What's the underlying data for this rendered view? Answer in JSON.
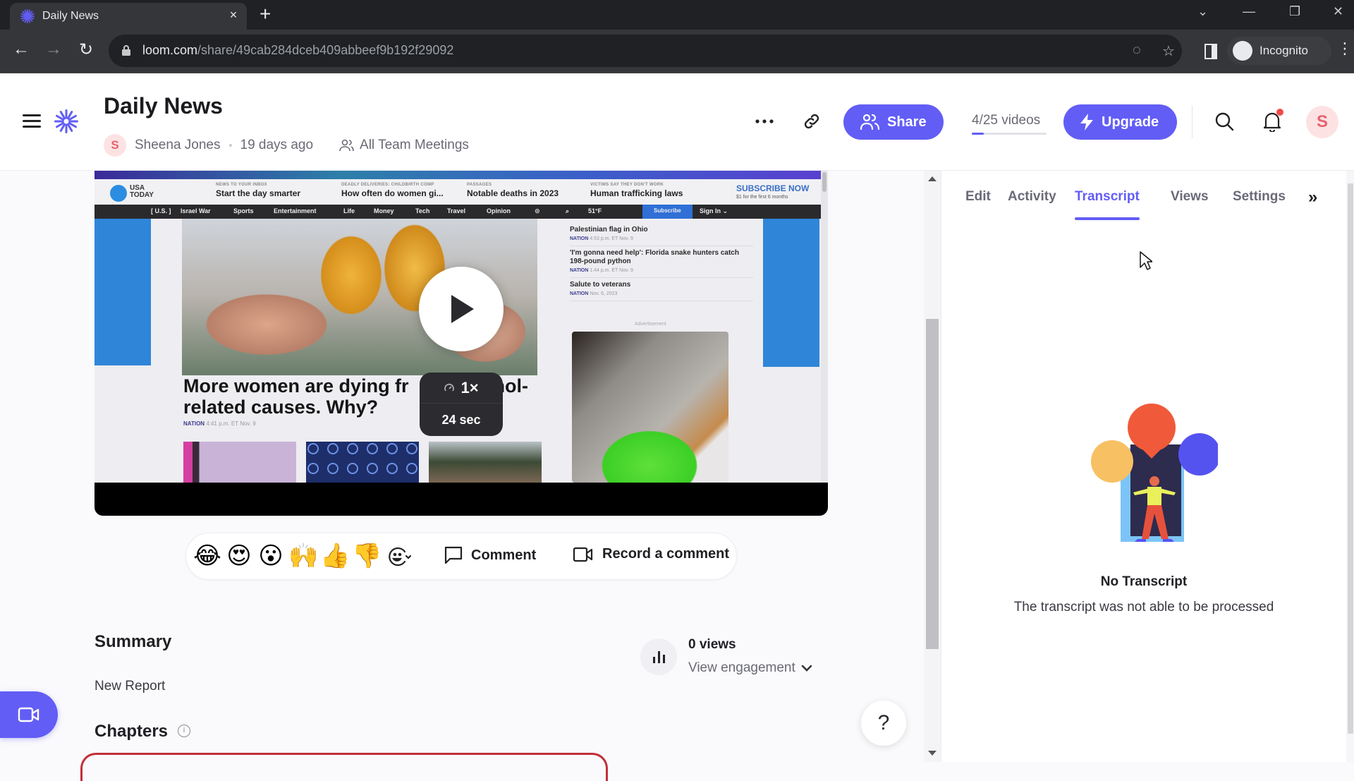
{
  "browser": {
    "tab_title": "Daily News",
    "tab_close": "×",
    "new_tab": "+",
    "url_host": "loom.com",
    "url_path": "/share/49cab284dceb409abbeef9b192f29092",
    "profile_label": "Incognito",
    "window_controls": [
      "chevron-down",
      "minimize",
      "restore",
      "close"
    ]
  },
  "header": {
    "title": "Daily News",
    "author_initial": "S",
    "author_name": "Sheena Jones",
    "time_ago": "19 days ago",
    "folder": "All Team Meetings",
    "share_label": "Share",
    "videos_count": "4/25 videos",
    "videos_used_fraction": 0.16,
    "upgrade_label": "Upgrade",
    "user_initial": "S",
    "accent_color": "#625df5"
  },
  "video": {
    "frame": {
      "logo_line1": "USA",
      "logo_line2": "TODAY",
      "header_items": [
        {
          "kicker": "NEWS TO YOUR INBOX",
          "headline": "Start the day smarter"
        },
        {
          "kicker": "DEADLY DELIVERIES: CHILDBIRTH COMP",
          "headline": "How often do women gi..."
        },
        {
          "kicker": "PASSAGES",
          "headline": "Notable deaths in 2023"
        },
        {
          "kicker": "VICTIMS SAY THEY DON'T WORK",
          "headline": "Human trafficking laws"
        }
      ],
      "subscribe_now": "SUBSCRIBE NOW",
      "subscribe_offer": "$1 for the first 6 months",
      "nav": [
        "[ U.S. ]",
        "Israel War",
        "Sports",
        "Entertainment",
        "Life",
        "Money",
        "Tech",
        "Travel",
        "Opinion"
      ],
      "weather": "51°F",
      "nav_subscribe": "Subscribe",
      "nav_signin": "Sign In ⌄",
      "main_headline": "More women are dying from alcohol-related causes. Why?",
      "main_headline_visible_l1": "More women are dying fr",
      "main_headline_visible_l1b": "hol-",
      "main_headline_visible_l2": "related causes. Why?",
      "main_meta_tag": "NATION",
      "main_meta_time": "4:41 p.m. ET Nov. 9",
      "stories": [
        {
          "title": "Palestinian flag in Ohio",
          "tag": "NATION",
          "time": "4:53 p.m. ET Nov. 9"
        },
        {
          "title": "'I'm gonna need help': Florida snake hunters catch 198-pound python",
          "tag": "NATION",
          "time": "1:44 p.m. ET Nov. 9"
        },
        {
          "title": "Salute to veterans",
          "tag": "NATION",
          "time": "Nov. 6, 2023"
        }
      ],
      "ad_label": "Advertisement"
    },
    "speed": "1×",
    "duration": "24 sec"
  },
  "reactions": {
    "emojis": [
      "😂",
      "😍",
      "😮",
      "🙌",
      "👍",
      "👎"
    ],
    "comment_label": "Comment",
    "record_comment_label": "Record a comment"
  },
  "summary": {
    "title": "Summary",
    "text": "New Report",
    "chapters_title": "Chapters",
    "chapters_info": "i"
  },
  "engagement": {
    "views": "0 views",
    "view_engagement": "View engagement"
  },
  "help_label": "?",
  "right_panel": {
    "tabs": [
      {
        "label": "Edit",
        "active": false
      },
      {
        "label": "Activity",
        "active": false
      },
      {
        "label": "Transcript",
        "active": true
      },
      {
        "label": "Views",
        "active": false
      },
      {
        "label": "Settings",
        "active": false
      }
    ],
    "more": "»",
    "empty_title": "No Transcript",
    "empty_desc": "The transcript was not able to be processed"
  }
}
